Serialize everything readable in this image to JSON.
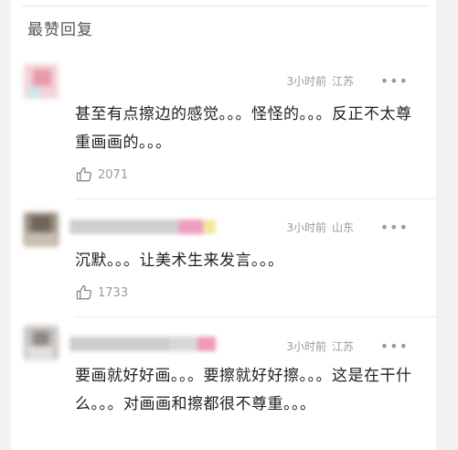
{
  "section": {
    "title": "最赞回复"
  },
  "comments": [
    {
      "time": "3小时前",
      "location": "江苏",
      "more": "•••",
      "text": "甚至有点擦边的感觉。。。怪怪的。。。反正不太尊重画画的。。。",
      "likes": "2071",
      "like_icon": "thumbs-up-icon"
    },
    {
      "time": "3小时前",
      "location": "山东",
      "more": "•••",
      "text": "沉默。。。让美术生来发言。。。",
      "likes": "1733",
      "like_icon": "thumbs-up-icon"
    },
    {
      "time": "3小时前",
      "location": "江苏",
      "more": "•••",
      "text": "要画就好好画。。。要擦就好好擦。。。这是在干什么。。。对画画和擦都很不尊重。。。",
      "likes": "",
      "like_icon": "thumbs-up-icon"
    }
  ],
  "colors": {
    "text": "#222222",
    "muted": "#9a9a9a",
    "accent_pink": "#e8739a"
  }
}
